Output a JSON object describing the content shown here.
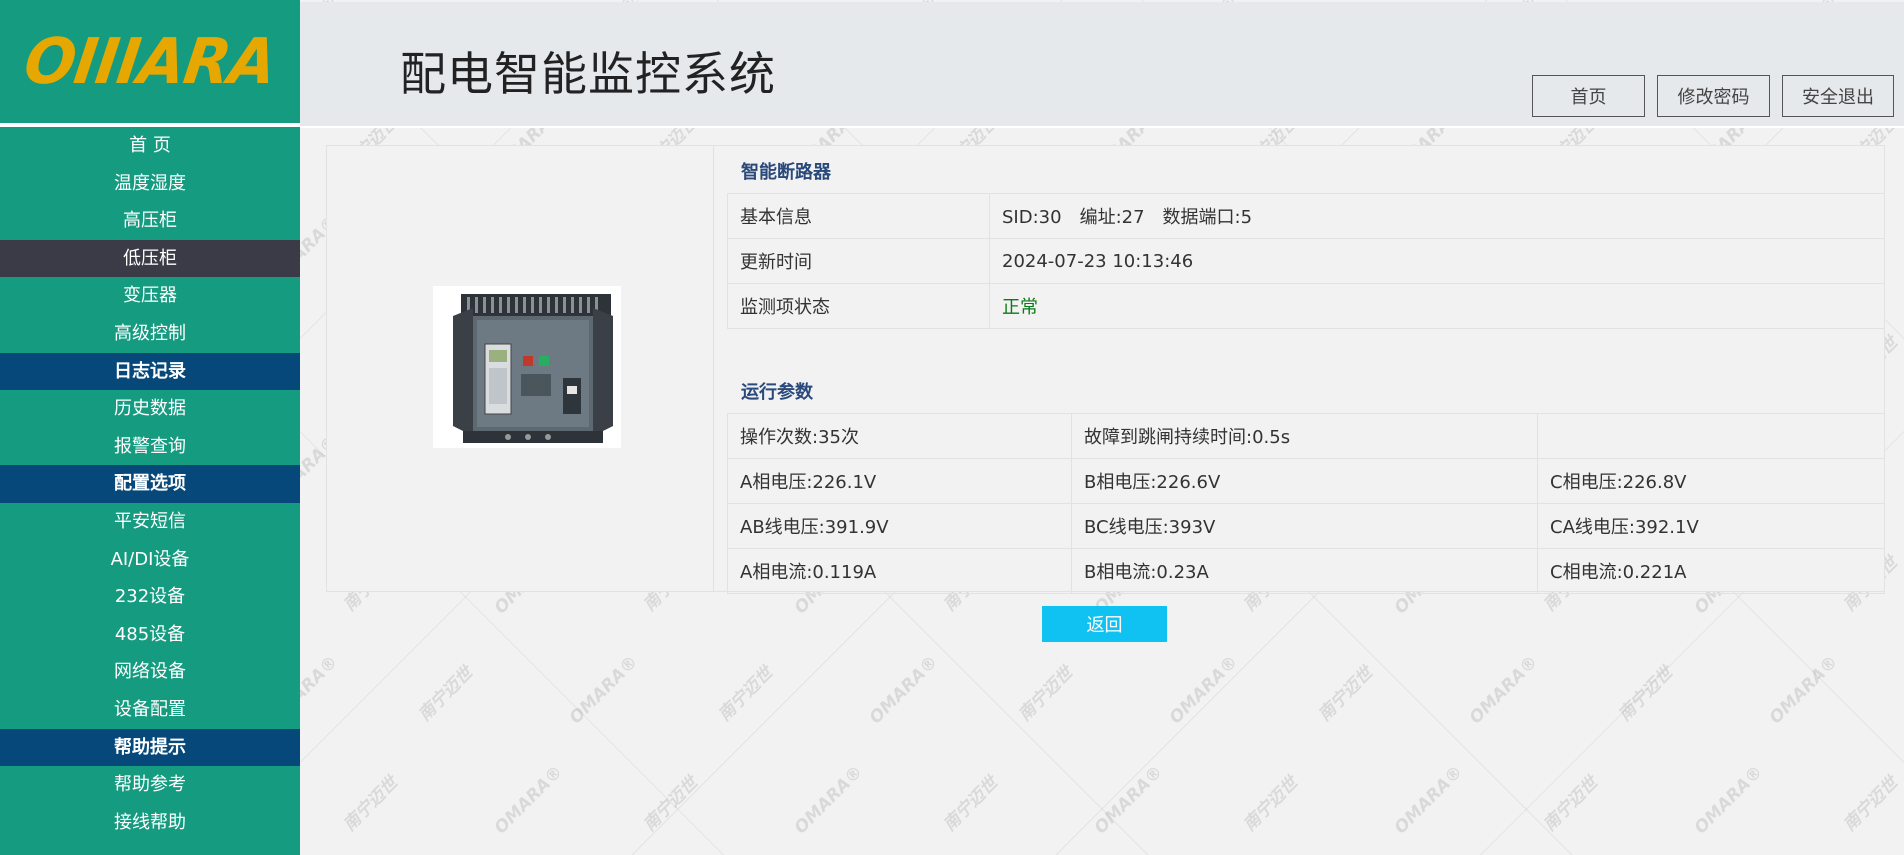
{
  "logo": {
    "text": "OIIIARA",
    "color": "#e6a800"
  },
  "header": {
    "title": "配电智能监控系统",
    "buttons": {
      "home": "首页",
      "change_password": "修改密码",
      "logout": "安全退出"
    }
  },
  "sidebar": {
    "items": [
      {
        "label": "首 页",
        "type": "item"
      },
      {
        "label": "温度湿度",
        "type": "item"
      },
      {
        "label": "高压柜",
        "type": "item"
      },
      {
        "label": "低压柜",
        "type": "item",
        "active": true
      },
      {
        "label": "变压器",
        "type": "item"
      },
      {
        "label": "高级控制",
        "type": "item"
      },
      {
        "label": "日志记录",
        "type": "section"
      },
      {
        "label": "历史数据",
        "type": "item"
      },
      {
        "label": "报警查询",
        "type": "item"
      },
      {
        "label": "配置选项",
        "type": "section"
      },
      {
        "label": "平安短信",
        "type": "item"
      },
      {
        "label": "AI/DI设备",
        "type": "item"
      },
      {
        "label": "232设备",
        "type": "item"
      },
      {
        "label": "485设备",
        "type": "item"
      },
      {
        "label": "网络设备",
        "type": "item"
      },
      {
        "label": "设备配置",
        "type": "item"
      },
      {
        "label": "帮助提示",
        "type": "section"
      },
      {
        "label": "帮助参考",
        "type": "item"
      },
      {
        "label": "接线帮助",
        "type": "item"
      }
    ]
  },
  "device": {
    "section_title": "智能断路器",
    "info": {
      "basic_label": "基本信息",
      "basic_value": "SID:30　编址:27　数据端口:5",
      "update_label": "更新时间",
      "update_value": "2024-07-23 10:13:46",
      "status_label": "监测项状态",
      "status_value": "正常"
    }
  },
  "params": {
    "section_title": "运行参数",
    "rows": [
      [
        "操作次数:35次",
        "故障到跳闸持续时间:0.5s",
        ""
      ],
      [
        "A相电压:226.1V",
        "B相电压:226.6V",
        "C相电压:226.8V"
      ],
      [
        "AB线电压:391.9V",
        "BC线电压:393V",
        "CA线电压:392.1V"
      ],
      [
        "A相电流:0.119A",
        "B相电流:0.23A",
        "C相电流:0.221A"
      ]
    ]
  },
  "actions": {
    "back": "返回"
  },
  "colors": {
    "sidebar_bg": "#159b80",
    "sidebar_active": "#3b3b47",
    "sidebar_section": "#06487a",
    "back_button": "#10c2f2",
    "status_ok": "#0b7a1a",
    "section_title": "#2a4a7b"
  },
  "watermark": {
    "brand": "OMARA®",
    "cn": "南宁迈世"
  }
}
